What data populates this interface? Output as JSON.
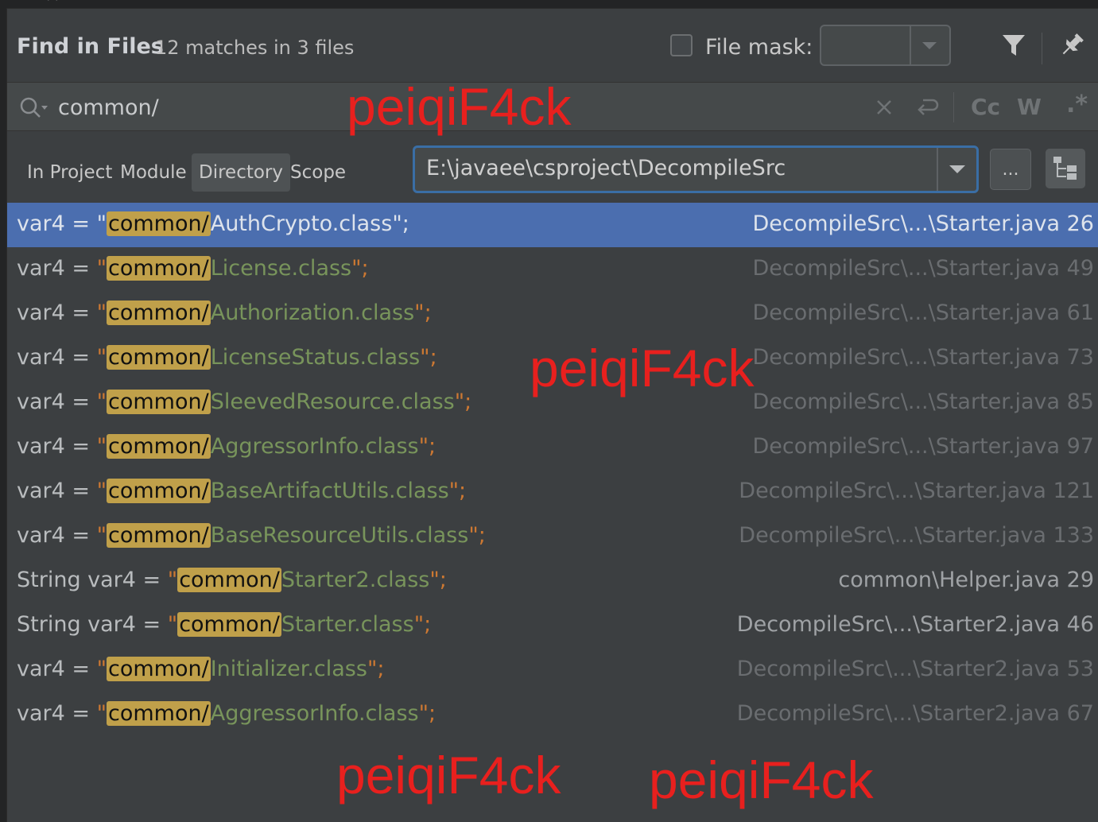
{
  "header": {
    "title": "Find in Files",
    "subtitle": "12 matches in 3 files",
    "file_mask_label": "File mask:",
    "file_mask_value": ""
  },
  "search": {
    "query": "common/",
    "match_case_label": "Cc",
    "words_label": "W",
    "regex_label": ".*"
  },
  "scope": {
    "tabs": [
      {
        "label": "In Project",
        "active": false
      },
      {
        "label": "Module",
        "active": false
      },
      {
        "label": "Directory",
        "active": true
      },
      {
        "label": "Scope",
        "active": false
      }
    ],
    "directory": "E:\\javaee\\csproject\\DecompileSrc",
    "browse_label": "..."
  },
  "results": [
    {
      "prefix": "var4 = ",
      "open": "\"",
      "match": "common/",
      "rest": "AuthCrypto.class",
      "close": "\";",
      "location": "DecompileSrc\\...\\Starter.java 26",
      "selected": true
    },
    {
      "prefix": "var4 = ",
      "open": "\"",
      "match": "common/",
      "rest": "License.class",
      "close": "\";",
      "location": "DecompileSrc\\...\\Starter.java 49",
      "selected": false
    },
    {
      "prefix": "var4 = ",
      "open": "\"",
      "match": "common/",
      "rest": "Authorization.class",
      "close": "\";",
      "location": "DecompileSrc\\...\\Starter.java 61",
      "selected": false
    },
    {
      "prefix": "var4 = ",
      "open": "\"",
      "match": "common/",
      "rest": "LicenseStatus.class",
      "close": "\";",
      "location": "DecompileSrc\\...\\Starter.java 73",
      "selected": false
    },
    {
      "prefix": "var4 = ",
      "open": "\"",
      "match": "common/",
      "rest": "SleevedResource.class",
      "close": "\";",
      "location": "DecompileSrc\\...\\Starter.java 85",
      "selected": false
    },
    {
      "prefix": "var4 = ",
      "open": "\"",
      "match": "common/",
      "rest": "AggressorInfo.class",
      "close": "\";",
      "location": "DecompileSrc\\...\\Starter.java 97",
      "selected": false
    },
    {
      "prefix": "var4 = ",
      "open": "\"",
      "match": "common/",
      "rest": "BaseArtifactUtils.class",
      "close": "\";",
      "location": "DecompileSrc\\...\\Starter.java 121",
      "selected": false
    },
    {
      "prefix": "var4 = ",
      "open": "\"",
      "match": "common/",
      "rest": "BaseResourceUtils.class",
      "close": "\";",
      "location": "DecompileSrc\\...\\Starter.java 133",
      "selected": false
    },
    {
      "prefix": "String var4 = ",
      "open": "\"",
      "match": "common/",
      "rest": "Starter2.class",
      "close": "\";",
      "location": "common\\Helper.java 29",
      "selected": false
    },
    {
      "prefix": "String var4 = ",
      "open": "\"",
      "match": "common/",
      "rest": "Starter.class",
      "close": "\";",
      "location": "DecompileSrc\\...\\Starter2.java 46",
      "selected": false
    },
    {
      "prefix": "var4 = ",
      "open": "\"",
      "match": "common/",
      "rest": "Initializer.class",
      "close": "\";",
      "location": "DecompileSrc\\...\\Starter2.java 53",
      "selected": false
    },
    {
      "prefix": "var4 = ",
      "open": "\"",
      "match": "common/",
      "rest": "AggressorInfo.class",
      "close": "\";",
      "location": "DecompileSrc\\...\\Starter2.java 67",
      "selected": false
    }
  ],
  "watermarks": [
    "peiqiF4ck",
    "peiqiF4ck",
    "peiqiF4ck",
    "peiqiF4ck"
  ],
  "colors": {
    "background": "#3c3f41",
    "selected_row": "#4b6eaf",
    "match_highlight": "#c0a04a",
    "string_literal": "#78945b",
    "punctuation": "#cc7832",
    "watermark": "#e8201e"
  }
}
